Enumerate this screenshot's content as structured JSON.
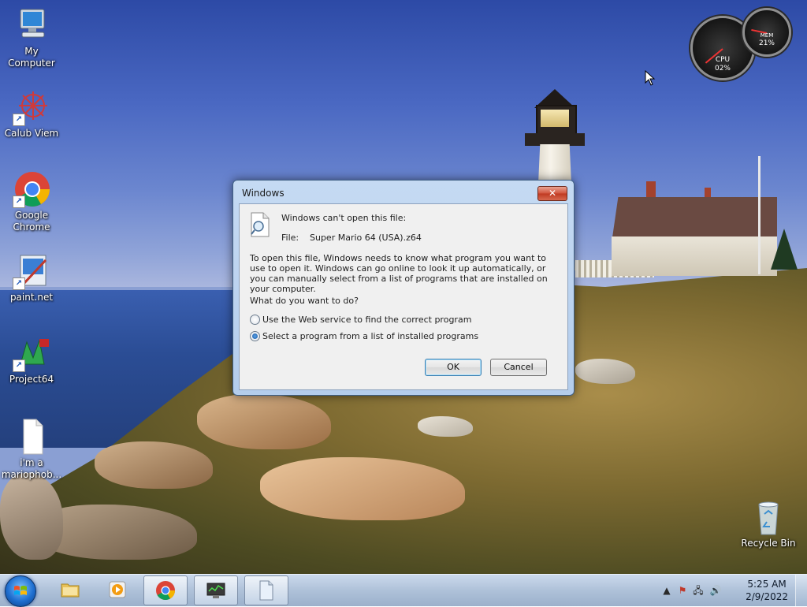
{
  "desktop_icons": [
    {
      "label": "My Computer",
      "icon": "computer-icon"
    },
    {
      "label": "Calub Viem",
      "icon": "snowflake-icon"
    },
    {
      "label": "Google Chrome",
      "icon": "chrome-icon"
    },
    {
      "label": "paint.net",
      "icon": "paintnet-icon"
    },
    {
      "label": "Project64",
      "icon": "project64-icon"
    },
    {
      "label": "i'm a mariophob...",
      "icon": "text-file-icon"
    },
    {
      "label": "Recycle Bin",
      "icon": "recycle-bin-icon"
    }
  ],
  "gadget": {
    "cpu_label": "CPU",
    "cpu_value": "02%",
    "mem_label": "MEM",
    "mem_value": "21%",
    "cpu_fraction": 0.02,
    "mem_fraction": 0.21
  },
  "dialog": {
    "title": "Windows",
    "close_label": "✕",
    "heading": "Windows can't open this file:",
    "file_label": "File:",
    "file_name": "Super Mario 64 (USA).z64",
    "explanation": "To open this file, Windows needs to know what program you want to use to open it. Windows can go online to look it up automatically, or you can manually select from a list of programs that are installed on your computer.",
    "question": "What do you want to do?",
    "options": [
      {
        "label": "Use the Web service to find the correct program",
        "selected": false
      },
      {
        "label": "Select a program from a list of installed programs",
        "selected": true
      }
    ],
    "ok_label": "OK",
    "cancel_label": "Cancel"
  },
  "taskbar": {
    "pinned": [
      {
        "name": "windows-explorer",
        "icon": "folder-icon",
        "active": false
      },
      {
        "name": "media-player",
        "icon": "media-player-icon",
        "active": false
      },
      {
        "name": "chrome",
        "icon": "chrome-icon",
        "active": true
      },
      {
        "name": "monitor",
        "icon": "monitor-icon",
        "active": true
      },
      {
        "name": "file",
        "icon": "blank-file-icon",
        "active": true
      }
    ],
    "time": "5:25 AM",
    "date": "2/9/2022"
  },
  "colors": {
    "accent": "#1a58a5",
    "close_red": "#c03a22",
    "dialog_frame": "#b4cdec"
  }
}
